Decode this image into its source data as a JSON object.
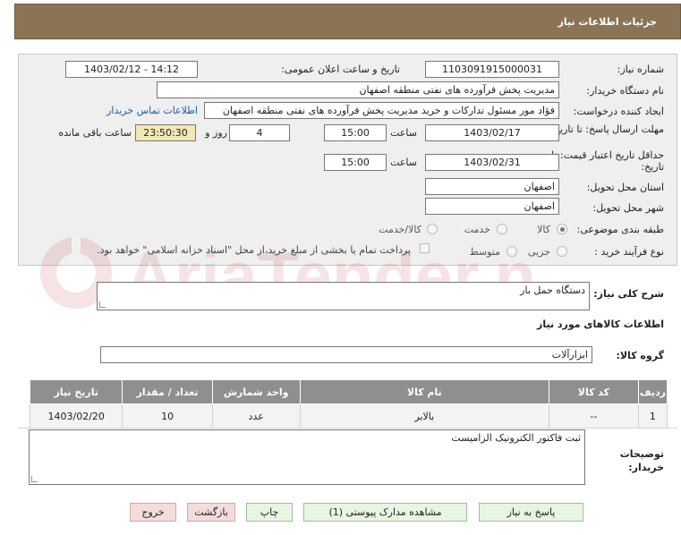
{
  "header": {
    "title": "جزئیات اطلاعات نیاز"
  },
  "form": {
    "need_number_label": "شماره نیاز:",
    "need_number": "1103091915000031",
    "announce_label": "تاریخ و ساعت اعلان عمومی:",
    "announce_value": "1403/02/12 - 14:12",
    "buyer_org_label": "نام دستگاه خریدار:",
    "buyer_org": "مدیریت پخش فرآورده های نفتی منطقه اصفهان",
    "requester_label": "ایجاد کننده درخواست:",
    "requester": "فؤاد مور مسئول تدارکات و خرید مدیریت پخش فرآورده های نفتی منطقه اصفهان",
    "buyer_contact_link": "اطلاعات تماس خریدار",
    "reply_deadline_label": "مهلت ارسال پاسخ: تا تاریخ:",
    "reply_date": "1403/02/17",
    "time_label": "ساعت",
    "reply_time": "15:00",
    "days_value": "4",
    "days_and_label": "روز و",
    "remaining_time": "23:50:30",
    "remaining_label": "ساعت باقی مانده",
    "price_validity_label": "حداقل تاریخ اعتبار قیمت: تا تاریخ:",
    "validity_date": "1403/02/31",
    "validity_time": "15:00",
    "province_label": "استان محل تحویل:",
    "province": "اصفهان",
    "city_label": "شهر محل تحویل:",
    "city": "اصفهان",
    "category_label": "طبقه بندی موضوعی:",
    "category_options": [
      "کالا",
      "خدمت",
      "کالا/خدمت"
    ],
    "process_label": "نوع فرآیند خرید :",
    "process_options": [
      "جزیی",
      "متوسط"
    ],
    "payment_note": "پرداخت تمام یا بخشی از مبلغ خرید،از محل \"اسناد خزانه اسلامی\" خواهد بود."
  },
  "summary": {
    "label": "شرح کلی نیاز:",
    "value": "دستگاه حمل بار"
  },
  "goods_info_title": "اطلاعات کالاهای مورد نیاز",
  "goods_group": {
    "label": "گروه کالا:",
    "value": "ابزارآلات"
  },
  "table": {
    "headers": [
      "ردیف",
      "کد کالا",
      "نام کالا",
      "واحد شمارش",
      "تعداد / مقدار",
      "تاریخ نیاز"
    ],
    "rows": [
      [
        "1",
        "--",
        "بالابر",
        "عدد",
        "10",
        "1403/02/20"
      ]
    ]
  },
  "buyer_notes": {
    "label": "توضیحات خریدار:",
    "value": "ثبت فاکتور الکترونیک الزامیست"
  },
  "buttons": {
    "reply": "پاسخ به نیاز",
    "view_docs": "مشاهده مدارک پیوستی (1)",
    "print": "چاپ",
    "back": "بازگشت",
    "exit": "خروج"
  },
  "watermark": {
    "text": "AriaTender.net"
  },
  "colors": {
    "header_bg": "#8a7455",
    "table_header_bg": "#8f8f8f",
    "button_bg": "#e9f5e3",
    "button_red_bg": "#f4dcdc"
  }
}
